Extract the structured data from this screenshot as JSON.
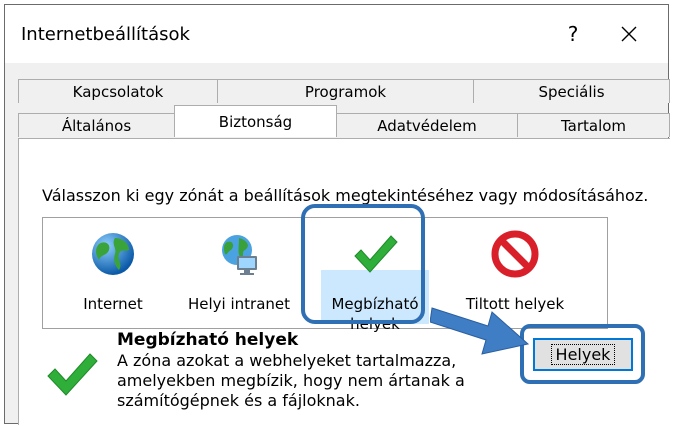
{
  "window": {
    "title": "Internetbeállítások",
    "help_label": "?",
    "close_label": "✕"
  },
  "tabs": {
    "row1": [
      "Kapcsolatok",
      "Programok",
      "Speciális"
    ],
    "row2": [
      "Általános",
      "Biztonság",
      "Adatvédelem",
      "Tartalom"
    ],
    "active": "Biztonság"
  },
  "security": {
    "instruction": "Válasszon ki egy zónát a beállítások megtekintéséhez vagy módosításához.",
    "zones": [
      {
        "label": "Internet",
        "icon": "globe-icon"
      },
      {
        "label": "Helyi intranet",
        "icon": "intranet-icon"
      },
      {
        "label": "Megbízható helyek",
        "label_line1": "Megbízható",
        "label_line2": "helyek",
        "icon": "green-check-icon",
        "selected": true
      },
      {
        "label": "Tiltott helyek",
        "icon": "restricted-icon"
      }
    ],
    "selected_zone": {
      "title": "Megbízható helyek",
      "description_lines": [
        "A zóna azokat a webhelyeket tartalmazza,",
        "amelyekben megbízik, hogy nem ártanak a",
        "számítógépnek és a fájloknak."
      ]
    },
    "sites_button": "Helyek"
  },
  "colors": {
    "highlight": "#2f6fb3",
    "selection": "#cce8ff",
    "button_focus": "#0078d7"
  }
}
